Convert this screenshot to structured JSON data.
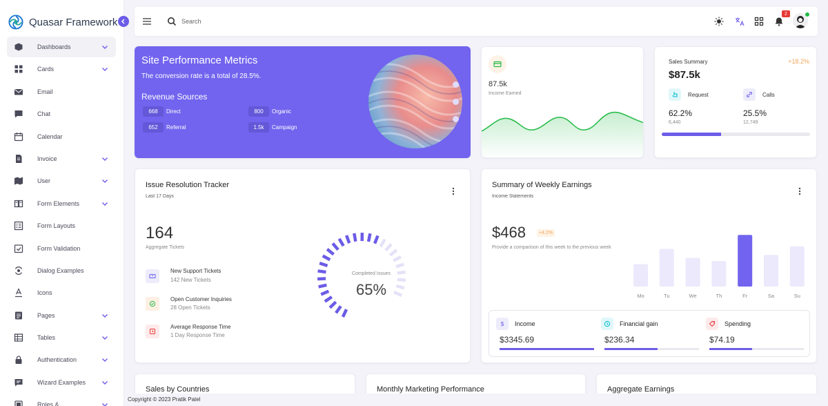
{
  "brand": {
    "name": "Quasar Framework"
  },
  "sidebar": {
    "items": [
      {
        "label": "Dashboards",
        "chevron": true,
        "active": true,
        "icon": "dashboard-icon"
      },
      {
        "label": "Cards",
        "chevron": true,
        "icon": "cards-icon"
      },
      {
        "label": "Email",
        "chevron": false,
        "icon": "email-icon"
      },
      {
        "label": "Chat",
        "chevron": false,
        "icon": "chat-icon"
      },
      {
        "label": "Calendar",
        "chevron": false,
        "icon": "calendar-icon"
      },
      {
        "label": "Invoice",
        "chevron": true,
        "icon": "invoice-icon"
      },
      {
        "label": "User",
        "chevron": true,
        "icon": "user-icon"
      },
      {
        "label": "Form Elements",
        "chevron": true,
        "icon": "form-elements-icon"
      },
      {
        "label": "Form Layouts",
        "chevron": false,
        "icon": "form-layouts-icon"
      },
      {
        "label": "Form Validation",
        "chevron": false,
        "icon": "form-validation-icon"
      },
      {
        "label": "Dialog Examples",
        "chevron": false,
        "icon": "dialog-icon"
      },
      {
        "label": "Icons",
        "chevron": false,
        "icon": "icons-icon"
      },
      {
        "label": "Pages",
        "chevron": true,
        "icon": "pages-icon"
      },
      {
        "label": "Tables",
        "chevron": true,
        "icon": "tables-icon"
      },
      {
        "label": "Authentication",
        "chevron": true,
        "icon": "lock-icon"
      },
      {
        "label": "Wizard Examples",
        "chevron": true,
        "icon": "wizard-icon"
      },
      {
        "label": "Roles &",
        "chevron": true,
        "icon": "roles-icon"
      }
    ]
  },
  "header": {
    "search_placeholder": "Search",
    "notification_count": "2"
  },
  "performance": {
    "title": "Site Performance Metrics",
    "subtitle": "The conversion rate is a total of 28.5%.",
    "revenue_title": "Revenue Sources",
    "sources": [
      {
        "value": "668",
        "label": "Direct"
      },
      {
        "value": "800",
        "label": "Organic"
      },
      {
        "value": "652",
        "label": "Referral"
      },
      {
        "value": "1.5k",
        "label": "Campaign"
      }
    ]
  },
  "income": {
    "value": "87.5k",
    "label": "Income Earned"
  },
  "sales_summary": {
    "title": "Sales Summary",
    "change": "+18.2%",
    "value": "$87.5k",
    "request": {
      "label": "Request",
      "pct": "62.2%",
      "count": "6,440"
    },
    "calls": {
      "label": "Calls",
      "pct": "25.5%",
      "count": "12,749"
    },
    "progress": 0.4
  },
  "issue": {
    "title": "Issue Resolution Tracker",
    "subtitle": "Last 17 Days",
    "total": "164",
    "total_label": "Aggregate Tickets",
    "rows": [
      {
        "title": "New Support Tickets",
        "sub": "142 New Tickets",
        "color": "#6c5ce7",
        "bg": "#ececfb"
      },
      {
        "title": "Open Customer Inquiries",
        "sub": "28 Open Tickets",
        "color": "#21ba45",
        "bg": "#fdf0e3"
      },
      {
        "title": "Average Response Time",
        "sub": "1 Day Response Time",
        "color": "#e53935",
        "bg": "#fdeaea"
      }
    ],
    "gauge_label": "Completed Issues",
    "gauge_value": "65%",
    "gauge_fraction": 0.65
  },
  "weekly": {
    "title": "Summary of Weekly Earnings",
    "subtitle": "Income Statements",
    "value": "$468",
    "change": "+4.2%",
    "description": "Provide a comparison of this week to the previous week",
    "summary": [
      {
        "label": "Income",
        "value": "$3345.69",
        "icon": "dollar-icon",
        "color": "#6c5ce7",
        "bg": "#ececfb",
        "progress": 1.0
      },
      {
        "label": "Financial gain",
        "value": "$236.34",
        "icon": "clock-icon",
        "color": "#00bcd4",
        "bg": "#e0f7fa",
        "progress": 0.56
      },
      {
        "label": "Spending",
        "value": "$74.19",
        "icon": "tag-icon",
        "color": "#e53935",
        "bg": "#fdeaea",
        "progress": 0.45
      }
    ]
  },
  "chart_data": {
    "type": "bar",
    "categories": [
      "Mo",
      "Tu",
      "We",
      "Th",
      "Fr",
      "Sa",
      "Su"
    ],
    "values": [
      37,
      62,
      47,
      42,
      85,
      52,
      66
    ],
    "highlight": "Fr",
    "ylim": [
      0,
      100
    ],
    "colors": {
      "base": "#ebe9fb",
      "highlight": "#7264ee"
    }
  },
  "bottom": {
    "titles": [
      "Sales by Countries",
      "Monthly Marketing Performance",
      "Aggregate Earnings"
    ]
  },
  "footer": {
    "text": "Copyright © 2023 Pratik Patel"
  }
}
